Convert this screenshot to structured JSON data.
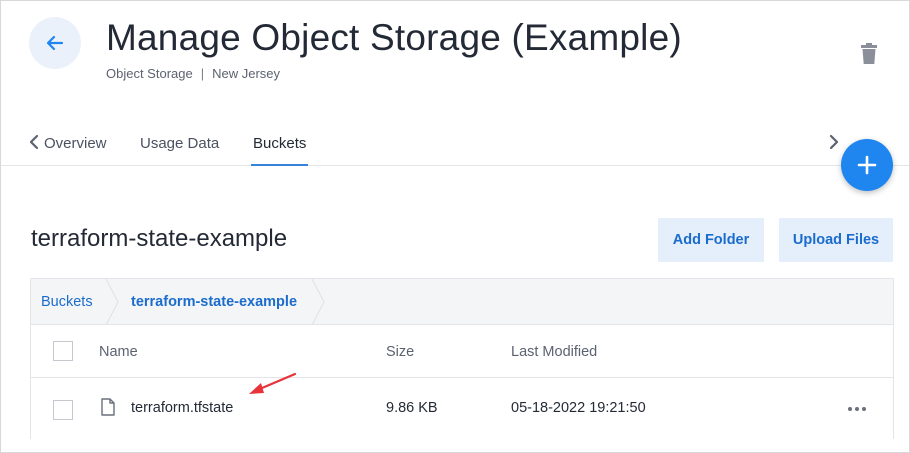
{
  "header": {
    "title": "Manage Object Storage (Example)",
    "service": "Object Storage",
    "region": "New Jersey",
    "separator": "|"
  },
  "tabs": [
    {
      "label": "Overview"
    },
    {
      "label": "Usage Data"
    },
    {
      "label": "Buckets",
      "active": true
    }
  ],
  "bucket": {
    "name": "terraform-state-example",
    "add_folder_label": "Add Folder",
    "upload_files_label": "Upload Files"
  },
  "breadcrumb": [
    {
      "label": "Buckets"
    },
    {
      "label": "terraform-state-example"
    }
  ],
  "table": {
    "columns": [
      "Name",
      "Size",
      "Last Modified"
    ],
    "rows": [
      {
        "name": "terraform.tfstate",
        "size": "9.86 KB",
        "modified": "05-18-2022 19:21:50"
      }
    ]
  },
  "icons": [
    "arrow-left-icon",
    "trash-icon",
    "chevron-left-icon",
    "chevron-right-icon",
    "plus-icon",
    "file-icon",
    "more-horizontal-icon"
  ],
  "colors": {
    "accent": "#1f86f0",
    "link": "#1a6ccd",
    "button_bg": "#e5eefb",
    "annotation_arrow": "#e8333c"
  }
}
